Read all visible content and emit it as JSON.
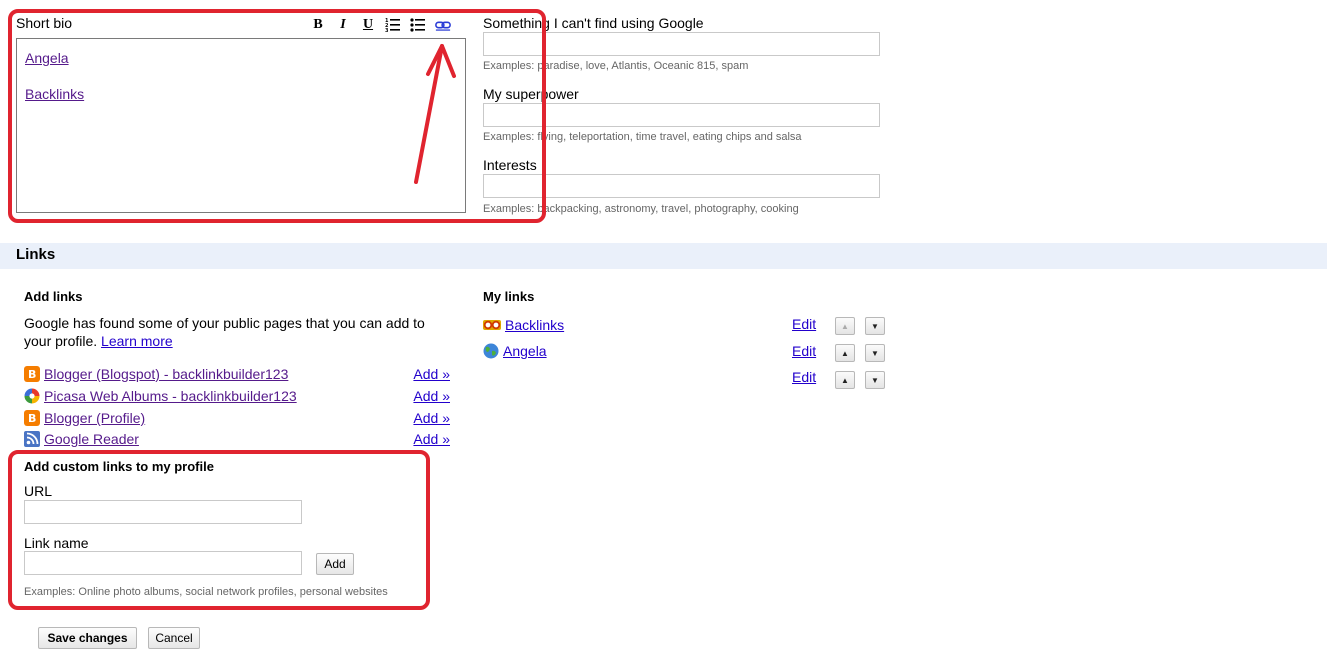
{
  "bio": {
    "label": "Short bio",
    "toolbar": {
      "bold": "B",
      "italic": "I",
      "underline": "U"
    },
    "links": [
      "Angela",
      "Backlinks"
    ]
  },
  "fields": [
    {
      "label": "Something I can't find using Google",
      "value": "",
      "example": "Examples: paradise, love, Atlantis, Oceanic 815, spam"
    },
    {
      "label": "My superpower",
      "value": "",
      "example": "Examples: flying, teleportation, time travel, eating chips and salsa"
    },
    {
      "label": "Interests",
      "value": "",
      "example": "Examples: backpacking, astronomy, travel, photography, cooking"
    }
  ],
  "links_section": {
    "title": "Links",
    "add_links": {
      "heading": "Add links",
      "description": "Google has found some of your public pages that you can add to your profile.",
      "learn_more": "Learn more",
      "services": [
        {
          "icon": "blogger-icon",
          "name": "Blogger (Blogspot) - backlinkbuilder123",
          "action": "Add »"
        },
        {
          "icon": "picasa-icon",
          "name": "Picasa Web Albums - backlinkbuilder123",
          "action": "Add »"
        },
        {
          "icon": "blogger-icon",
          "name": "Blogger (Profile)",
          "action": "Add »"
        },
        {
          "icon": "reader-icon",
          "name": "Google Reader",
          "action": "Add »"
        }
      ]
    },
    "custom_links": {
      "heading": "Add custom links to my profile",
      "url_label": "URL",
      "url_value": "",
      "name_label": "Link name",
      "name_value": "",
      "add_button": "Add",
      "example": "Examples: Online photo albums, social network profiles, personal websites"
    },
    "my_links": {
      "heading": "My links",
      "items": [
        {
          "icon": "glasses-icon",
          "name": "Backlinks",
          "edit": "Edit"
        },
        {
          "icon": "globe-icon",
          "name": "Angela",
          "edit": "Edit"
        },
        {
          "icon": "",
          "name": "",
          "edit": "Edit"
        }
      ]
    }
  },
  "buttons": {
    "save": "Save changes",
    "cancel": "Cancel"
  },
  "colors": {
    "annotation": "#e0242f",
    "links_bar": "#eaf0fa",
    "link": "#551a8b"
  }
}
